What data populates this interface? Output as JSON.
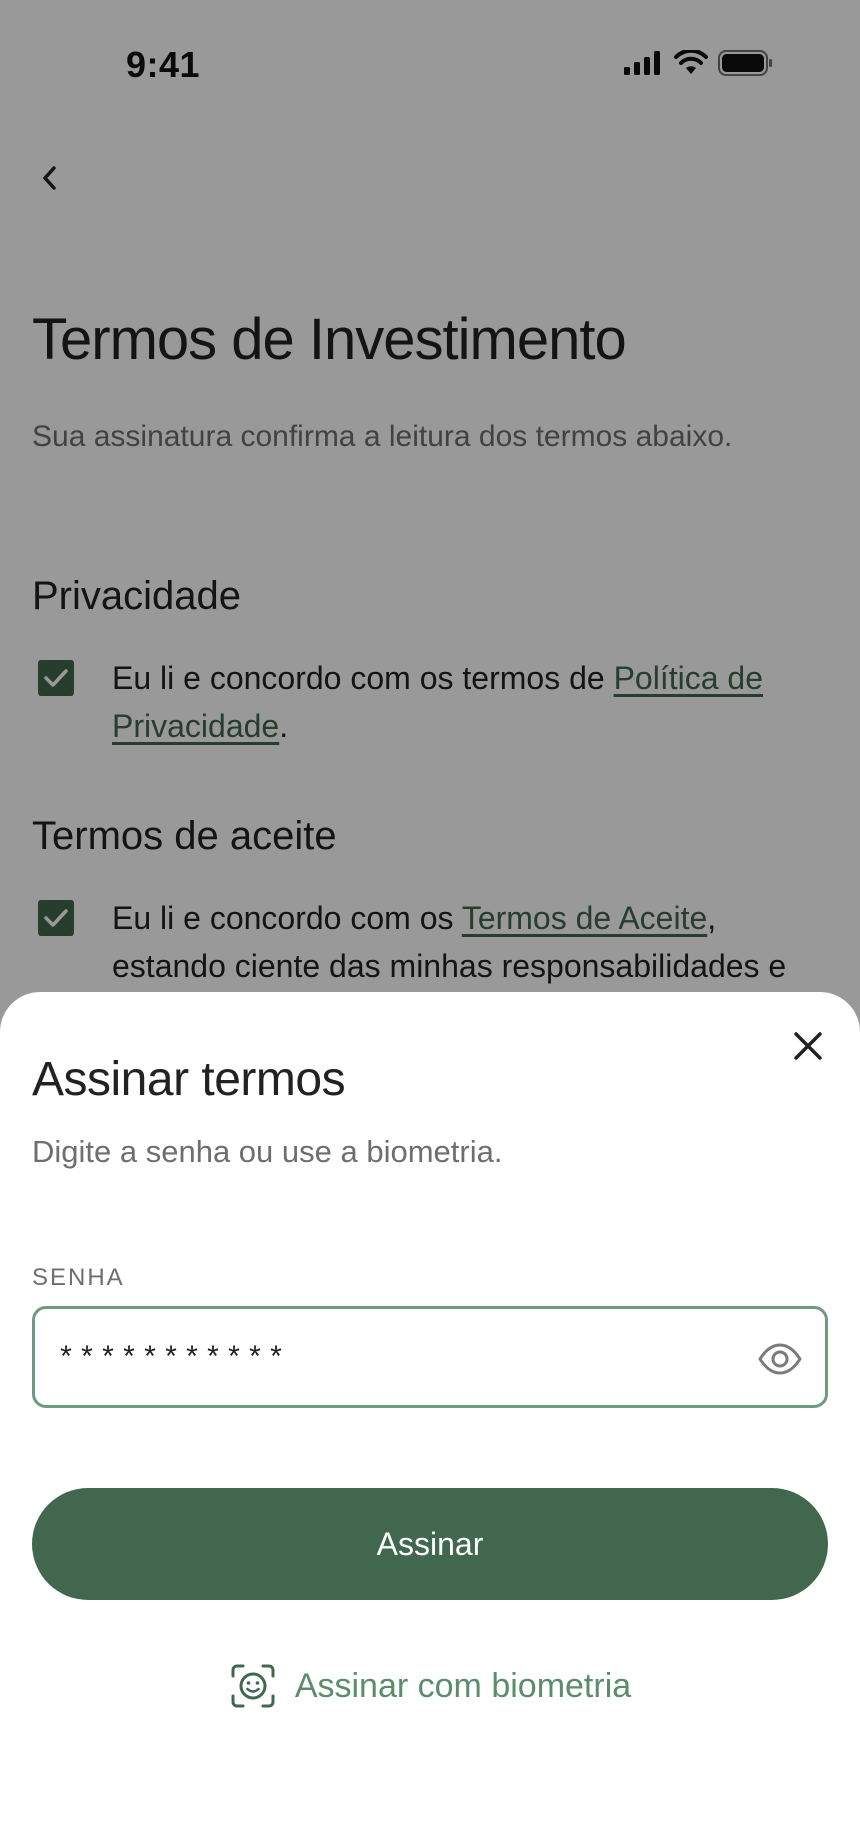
{
  "status_bar": {
    "time": "9:41"
  },
  "page": {
    "title": "Termos de Investimento",
    "subtitle": "Sua assinatura confirma a leitura dos termos abaixo.",
    "privacy": {
      "heading": "Privacidade",
      "checked": true,
      "text_before": "Eu li e concordo com os termos de ",
      "link_text": "Política de Privacidade",
      "text_after": "."
    },
    "terms": {
      "heading": "Termos de aceite",
      "checked": true,
      "text_before": "Eu li e concordo com os ",
      "link_text": "Termos de Aceite",
      "text_after": ", estando ciente das minhas responsabilidades e"
    }
  },
  "sheet": {
    "title": "Assinar termos",
    "subtitle": "Digite a senha ou use a biometria.",
    "password": {
      "label": "SENHA",
      "value": "***********"
    },
    "sign_button": "Assinar",
    "biometric_link": "Assinar com biometria"
  },
  "colors": {
    "accent": "#41684f",
    "link": "#5b8c6c",
    "input_border": "#6e9b80"
  },
  "icons": [
    "back-chevron-icon",
    "signal-icon",
    "wifi-icon",
    "battery-icon",
    "checkbox-checked-icon",
    "close-icon",
    "eye-icon",
    "face-scan-icon"
  ]
}
